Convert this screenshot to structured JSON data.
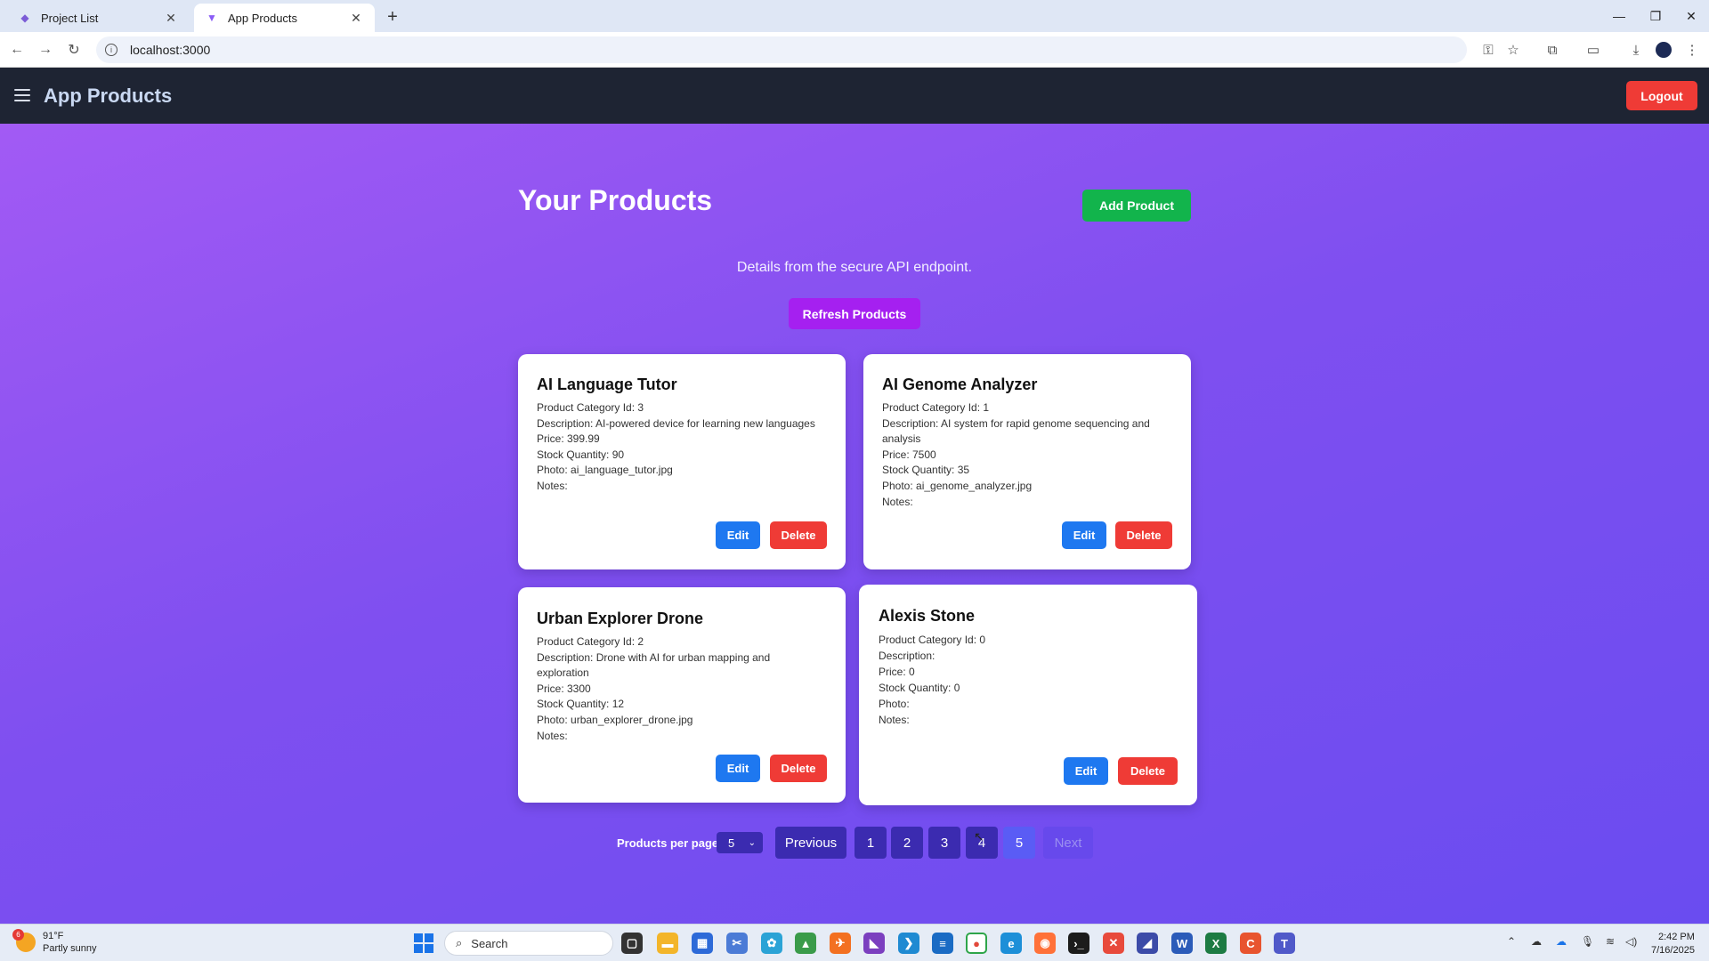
{
  "browser": {
    "tabs": [
      {
        "title": "Project List",
        "active": false
      },
      {
        "title": "App Products",
        "active": true
      }
    ],
    "url": "localhost:3000"
  },
  "app": {
    "title": "App Products",
    "logout_label": "Logout",
    "page_title": "Your Products",
    "add_label": "Add Product",
    "subtitle": "Details from the secure API endpoint.",
    "refresh_label": "Refresh Products"
  },
  "products": [
    {
      "name": "AI Language Tutor",
      "category": "Product Category Id: 3",
      "description": "Description: AI-powered device for learning new languages",
      "price": "Price: 399.99",
      "stock": "Stock Quantity: 90",
      "photo": "Photo: ai_language_tutor.jpg",
      "notes": "Notes:"
    },
    {
      "name": "AI Genome Analyzer",
      "category": "Product Category Id: 1",
      "description": "Description: AI system for rapid genome sequencing and analysis",
      "price": "Price: 7500",
      "stock": "Stock Quantity: 35",
      "photo": "Photo: ai_genome_analyzer.jpg",
      "notes": "Notes:"
    },
    {
      "name": "Urban Explorer Drone",
      "category": "Product Category Id: 2",
      "description": "Description: Drone with AI for urban mapping and exploration",
      "price": "Price: 3300",
      "stock": "Stock Quantity: 12",
      "photo": "Photo: urban_explorer_drone.jpg",
      "notes": "Notes:"
    },
    {
      "name": "Alexis Stone",
      "category": "Product Category Id: 0",
      "description": "Description:",
      "price": "Price: 0",
      "stock": "Stock Quantity: 0",
      "photo": "Photo:",
      "notes": "Notes:"
    }
  ],
  "card_actions": {
    "edit": "Edit",
    "delete": "Delete"
  },
  "pagination": {
    "per_page_label": "Products per page:",
    "per_page_value": "5",
    "previous": "Previous",
    "pages": [
      "1",
      "2",
      "3",
      "4",
      "5"
    ],
    "current_page": "5",
    "next": "Next"
  },
  "taskbar": {
    "weather_temp": "91°F",
    "weather_desc": "Partly sunny",
    "weather_badge": "6",
    "search_placeholder": "Search",
    "time": "2:42 PM",
    "date": "7/16/2025"
  },
  "colors": {
    "header_bg": "#1e2433",
    "logout": "#ef3b36",
    "add": "#12b44c",
    "refresh": "#a520f0",
    "edit": "#1e78f0",
    "delete": "#ef3b36",
    "page_button": "#3b2bb0"
  }
}
